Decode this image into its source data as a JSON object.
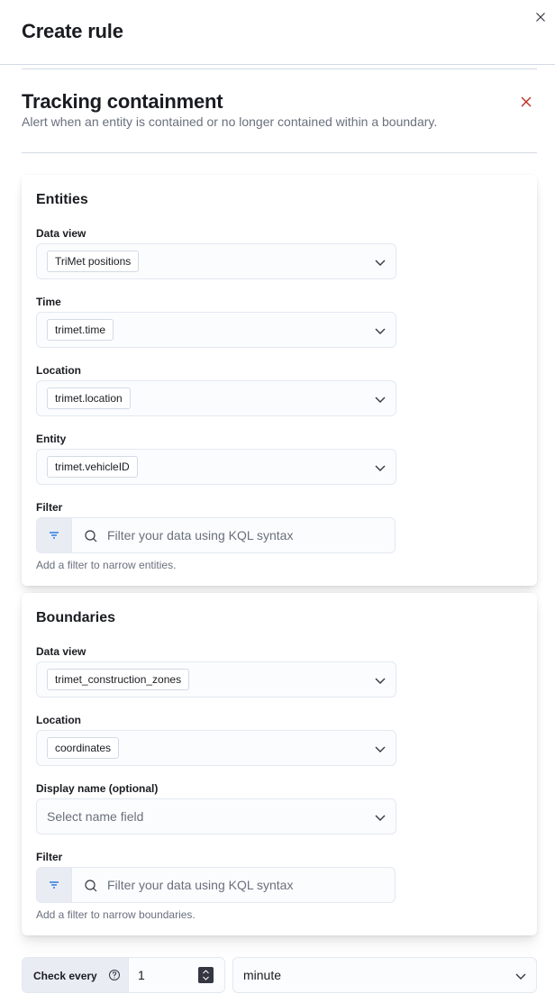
{
  "flyout": {
    "title": "Create rule",
    "close_icon": "close-icon"
  },
  "rule_type": {
    "title": "Tracking containment",
    "description": "Alert when an entity is contained or no longer contained within a boundary.",
    "remove_icon": "cross-icon",
    "remove_color": "#bd271e"
  },
  "entities": {
    "title": "Entities",
    "data_view": {
      "label": "Data view",
      "value": "TriMet positions"
    },
    "time": {
      "label": "Time",
      "value": "trimet.time"
    },
    "location": {
      "label": "Location",
      "value": "trimet.location"
    },
    "entity": {
      "label": "Entity",
      "value": "trimet.vehicleID"
    },
    "filter": {
      "label": "Filter",
      "placeholder": "Filter your data using KQL syntax",
      "help": "Add a filter to narrow entities."
    }
  },
  "boundaries": {
    "title": "Boundaries",
    "data_view": {
      "label": "Data view",
      "value": "trimet_construction_zones"
    },
    "location": {
      "label": "Location",
      "value": "coordinates"
    },
    "display_name": {
      "label": "Display name (optional)",
      "placeholder": "Select name field"
    },
    "filter": {
      "label": "Filter",
      "placeholder": "Filter your data using KQL syntax",
      "help": "Add a filter to narrow boundaries."
    }
  },
  "schedule": {
    "check_every_label": "Check every",
    "interval_value": "1",
    "unit_value": "minute"
  },
  "colors": {
    "accent": "#0b64dd",
    "danger": "#bd271e",
    "text": "#1a1c21",
    "subdued": "#69707d"
  }
}
